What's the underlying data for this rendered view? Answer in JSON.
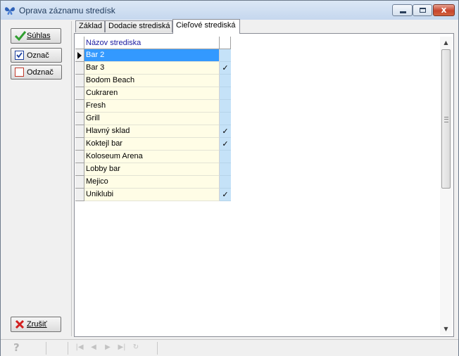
{
  "window": {
    "title": "Oprava záznamu stredísk",
    "icon": "butterfly-icon",
    "close_glyph": "x"
  },
  "left_panel": {
    "suhlas_label": "Súhlas",
    "oznac_label": "Označ",
    "odznac_label": "Odznač",
    "zrusit_label": "Zrušiť"
  },
  "tabs": [
    {
      "label": "Základ",
      "active": false
    },
    {
      "label": "Dodacie strediská",
      "active": false
    },
    {
      "label": "Cieľové strediská",
      "active": true
    }
  ],
  "grid": {
    "column_name": "Názov strediska",
    "rows": [
      {
        "name": "Bar 2",
        "checked": "",
        "selected": true
      },
      {
        "name": "Bar 3",
        "checked": "✓",
        "selected": false
      },
      {
        "name": "Bodom Beach",
        "checked": "",
        "selected": false
      },
      {
        "name": "Cukraren",
        "checked": "",
        "selected": false
      },
      {
        "name": "Fresh",
        "checked": "",
        "selected": false
      },
      {
        "name": " Grill",
        "checked": "",
        "selected": false
      },
      {
        "name": "Hlavný sklad",
        "checked": "✓",
        "selected": false
      },
      {
        "name": "Koktejl bar",
        "checked": "✓",
        "selected": false
      },
      {
        "name": "Koloseum Arena",
        "checked": "",
        "selected": false
      },
      {
        "name": "Lobby bar",
        "checked": "",
        "selected": false
      },
      {
        "name": "Mejico",
        "checked": "",
        "selected": false
      },
      {
        "name": "Uniklubi",
        "checked": "✓",
        "selected": false
      }
    ]
  },
  "scrollbar": {
    "up": "▲",
    "down": "▼"
  },
  "statusbar": {
    "help": "?",
    "nav": [
      "|◀",
      "◀",
      "▶",
      "▶|",
      "↻"
    ]
  },
  "colors": {
    "selection": "#3399ff",
    "cell_bg": "#fffde6",
    "check_bg": "#c5e2f8",
    "header_text": "#1a1aa0"
  }
}
